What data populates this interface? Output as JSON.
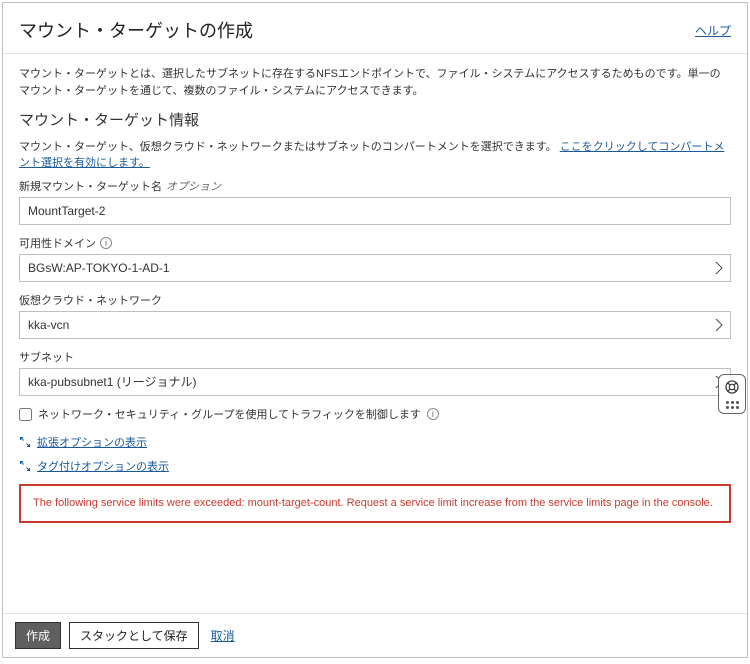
{
  "header": {
    "title": "マウント・ターゲットの作成",
    "help": "ヘルプ"
  },
  "description": "マウント・ターゲットとは、選択したサブネットに存在するNFSエンドポイントで、ファイル・システムにアクセスするためものです。単一のマウント・ターゲットを通じて、複数のファイル・システムにアクセスできます。",
  "section": {
    "title": "マウント・ターゲット情報",
    "hint_prefix": "マウント・ターゲット、仮想クラウド・ネットワークまたはサブネットのコンパートメントを選択できます。",
    "hint_link": "ここをクリックしてコンパートメント選択を有効にします。"
  },
  "fields": {
    "name_label": "新規マウント・ターゲット名",
    "name_optional": "オプション",
    "name_value": "MountTarget-2",
    "ad_label": "可用性ドメイン",
    "ad_value": "BGsW:AP-TOKYO-1-AD-1",
    "vcn_label": "仮想クラウド・ネットワーク",
    "vcn_value": "kka-vcn",
    "subnet_label": "サブネット",
    "subnet_value": "kka-pubsubnet1 (リージョナル)",
    "nsg_label": "ネットワーク・セキュリティ・グループを使用してトラフィックを制御します"
  },
  "toggles": {
    "advanced": "拡張オプションの表示",
    "tagging": "タグ付けオプションの表示"
  },
  "error": "The following service limits were exceeded: mount-target-count. Request a service limit increase from the service limits page in the console.",
  "footer": {
    "create": "作成",
    "save_stack": "スタックとして保存",
    "cancel": "取消"
  }
}
